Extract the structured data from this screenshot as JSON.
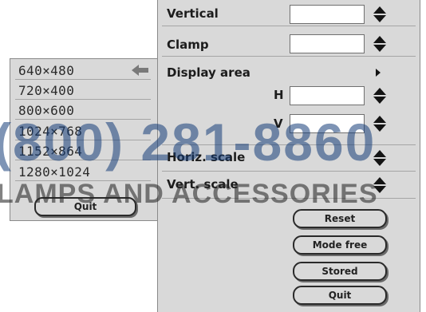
{
  "resolution_menu": {
    "items": [
      "640×480",
      "720×400",
      "800×600",
      "1024×768",
      "1152×864",
      "1280×1024"
    ],
    "quit_label": "Quit"
  },
  "main_panel": {
    "vertical_label": "Vertical",
    "clamp_label": "Clamp",
    "display_area_label": "Display area",
    "h_label": "H",
    "v_label": "V",
    "horiz_scale_label": "Horiz. scale",
    "vert_scale_label": "Vert. scale",
    "buttons": {
      "reset": "Reset",
      "mode_free": "Mode free",
      "stored": "Stored",
      "quit": "Quit"
    }
  },
  "watermark": {
    "phone": "(800) 281-8860",
    "text": "LAMPS AND ACCESSORIES"
  }
}
